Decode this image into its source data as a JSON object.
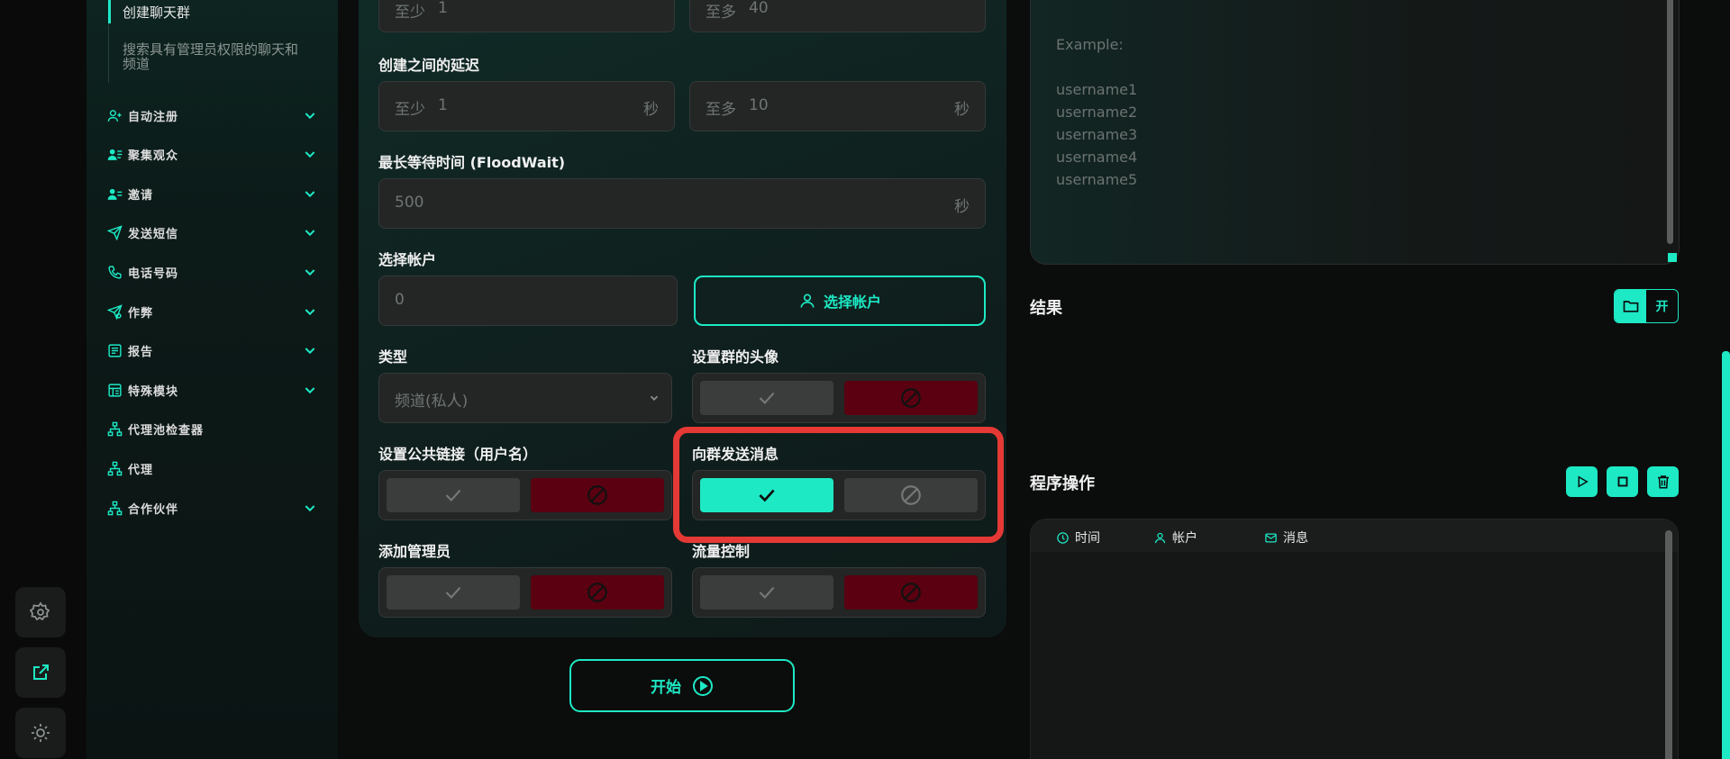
{
  "accent": "#1de9c5",
  "danger": "#5a0010",
  "highlight": "#e53935",
  "sidebar": {
    "sub_items": [
      "创建聊天群",
      "搜索具有管理员权限的聊天和频道"
    ],
    "nav": [
      {
        "label": "自动注册",
        "icon": "user-plus-icon",
        "chevron": true
      },
      {
        "label": "聚集观众",
        "icon": "users-list-icon",
        "chevron": true
      },
      {
        "label": "邀请",
        "icon": "user-list-icon",
        "chevron": true
      },
      {
        "label": "发送短信",
        "icon": "send-icon",
        "chevron": true
      },
      {
        "label": "电话号码",
        "icon": "phone-icon",
        "chevron": true
      },
      {
        "label": "作弊",
        "icon": "send-gear-icon",
        "chevron": true
      },
      {
        "label": "报告",
        "icon": "report-icon",
        "chevron": true
      },
      {
        "label": "特殊模块",
        "icon": "module-icon",
        "chevron": true
      },
      {
        "label": "代理池检查器",
        "icon": "network-icon",
        "chevron": false
      },
      {
        "label": "代理",
        "icon": "network-icon",
        "chevron": false
      },
      {
        "label": "合作伙伴",
        "icon": "network-icon",
        "chevron": true
      }
    ]
  },
  "rail": [
    "settings-icon",
    "external-link-icon",
    "theme-icon"
  ],
  "form": {
    "top_min": {
      "prefix": "至少",
      "value": "1"
    },
    "top_max": {
      "prefix": "至多",
      "value": "40"
    },
    "delay_label": "创建之间的延迟",
    "delay_min": {
      "prefix": "至少",
      "value": "1",
      "suffix": "秒"
    },
    "delay_max": {
      "prefix": "至多",
      "value": "10",
      "suffix": "秒"
    },
    "floodwait_label": "最长等待时间 (FloodWait)",
    "floodwait": {
      "value": "500",
      "suffix": "秒"
    },
    "accounts_label": "选择帐户",
    "accounts_value": "0",
    "accounts_button": "选择帐户",
    "type_label": "类型",
    "type_value": "频道(私人)",
    "avatar_label": "设置群的头像",
    "public_link_label": "设置公共链接（用户名）",
    "send_message_label": "向群发送消息",
    "add_admin_label": "添加管理员",
    "flow_control_label": "流量控制",
    "start_button": "开始"
  },
  "usernames": {
    "lines": [
      "Example:",
      "",
      "username1",
      "username2",
      "username3",
      "username4",
      "username5"
    ]
  },
  "results": {
    "title": "结果",
    "open_label": "开"
  },
  "operations": {
    "title": "程序操作"
  },
  "log": {
    "columns": [
      "时间",
      "帐户",
      "消息"
    ]
  }
}
